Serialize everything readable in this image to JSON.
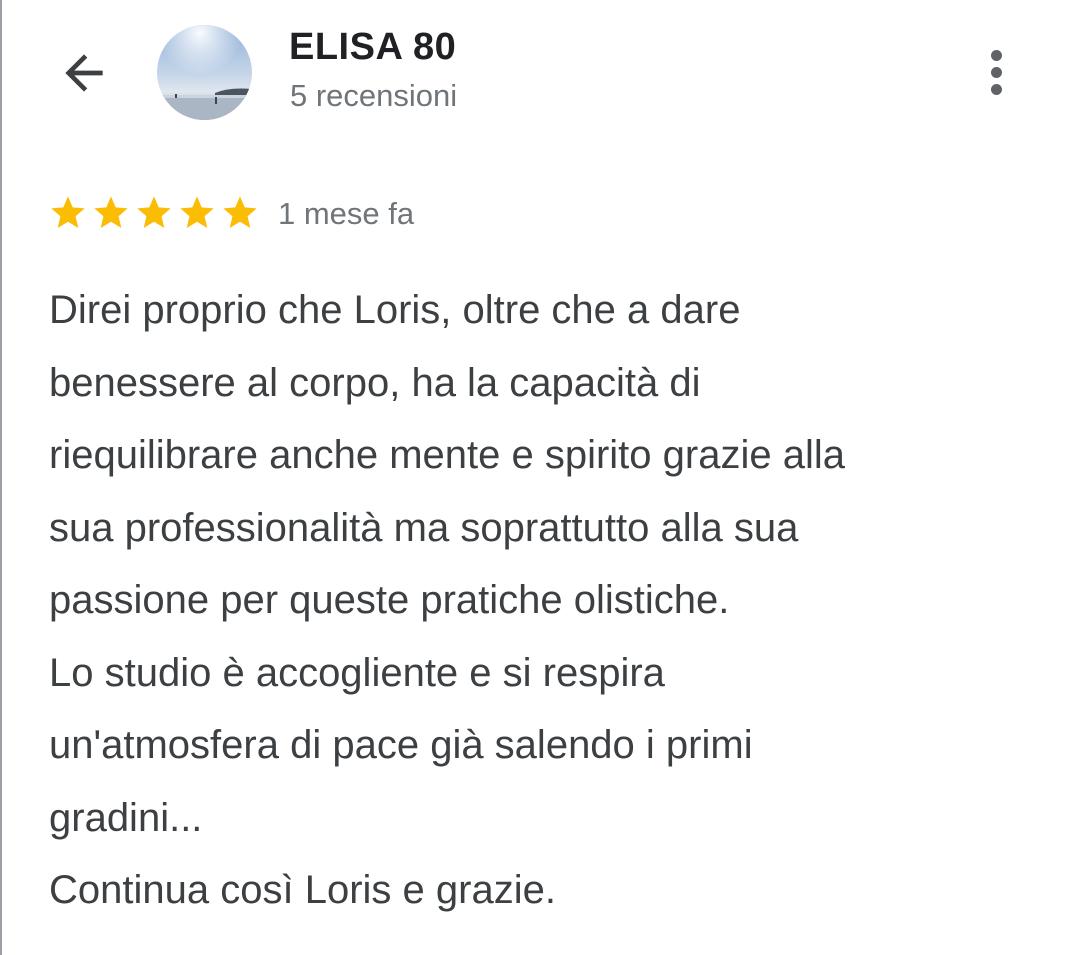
{
  "header": {
    "back_icon": "arrow-back-icon",
    "reviewer_name": "ELISA 80",
    "review_count": "5 recensioni",
    "menu_icon": "more-vert-icon"
  },
  "review": {
    "rating": 5,
    "rating_max": 5,
    "star_color": "#fbbc04",
    "date": "1 mese fa",
    "lines": [
      "Direi proprio che Loris, oltre che a dare",
      "benessere al corpo, ha la capacità di",
      "riequilibrare anche mente e spirito grazie alla",
      "sua professionalità ma soprattutto alla sua",
      "passione per queste pratiche olistiche.",
      "Lo studio è accogliente e si respira",
      "un'atmosfera di pace già salendo i primi",
      "gradini...",
      "Continua così Loris e grazie."
    ]
  }
}
